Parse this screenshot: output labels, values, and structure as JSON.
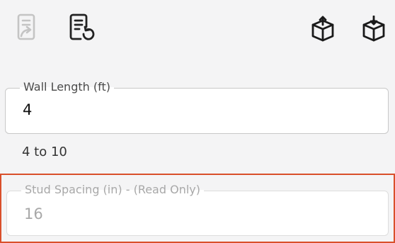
{
  "toolbar": {
    "icons": [
      "document-send-icon",
      "document-reset-icon",
      "export-box-icon",
      "import-box-icon"
    ]
  },
  "wall_length": {
    "label": "Wall Length (ft)",
    "value": "4",
    "hint": "4 to 10"
  },
  "stud_spacing": {
    "label": "Stud Spacing (in) - (Read Only)",
    "value": "16",
    "highlight_color": "#d9502b"
  }
}
